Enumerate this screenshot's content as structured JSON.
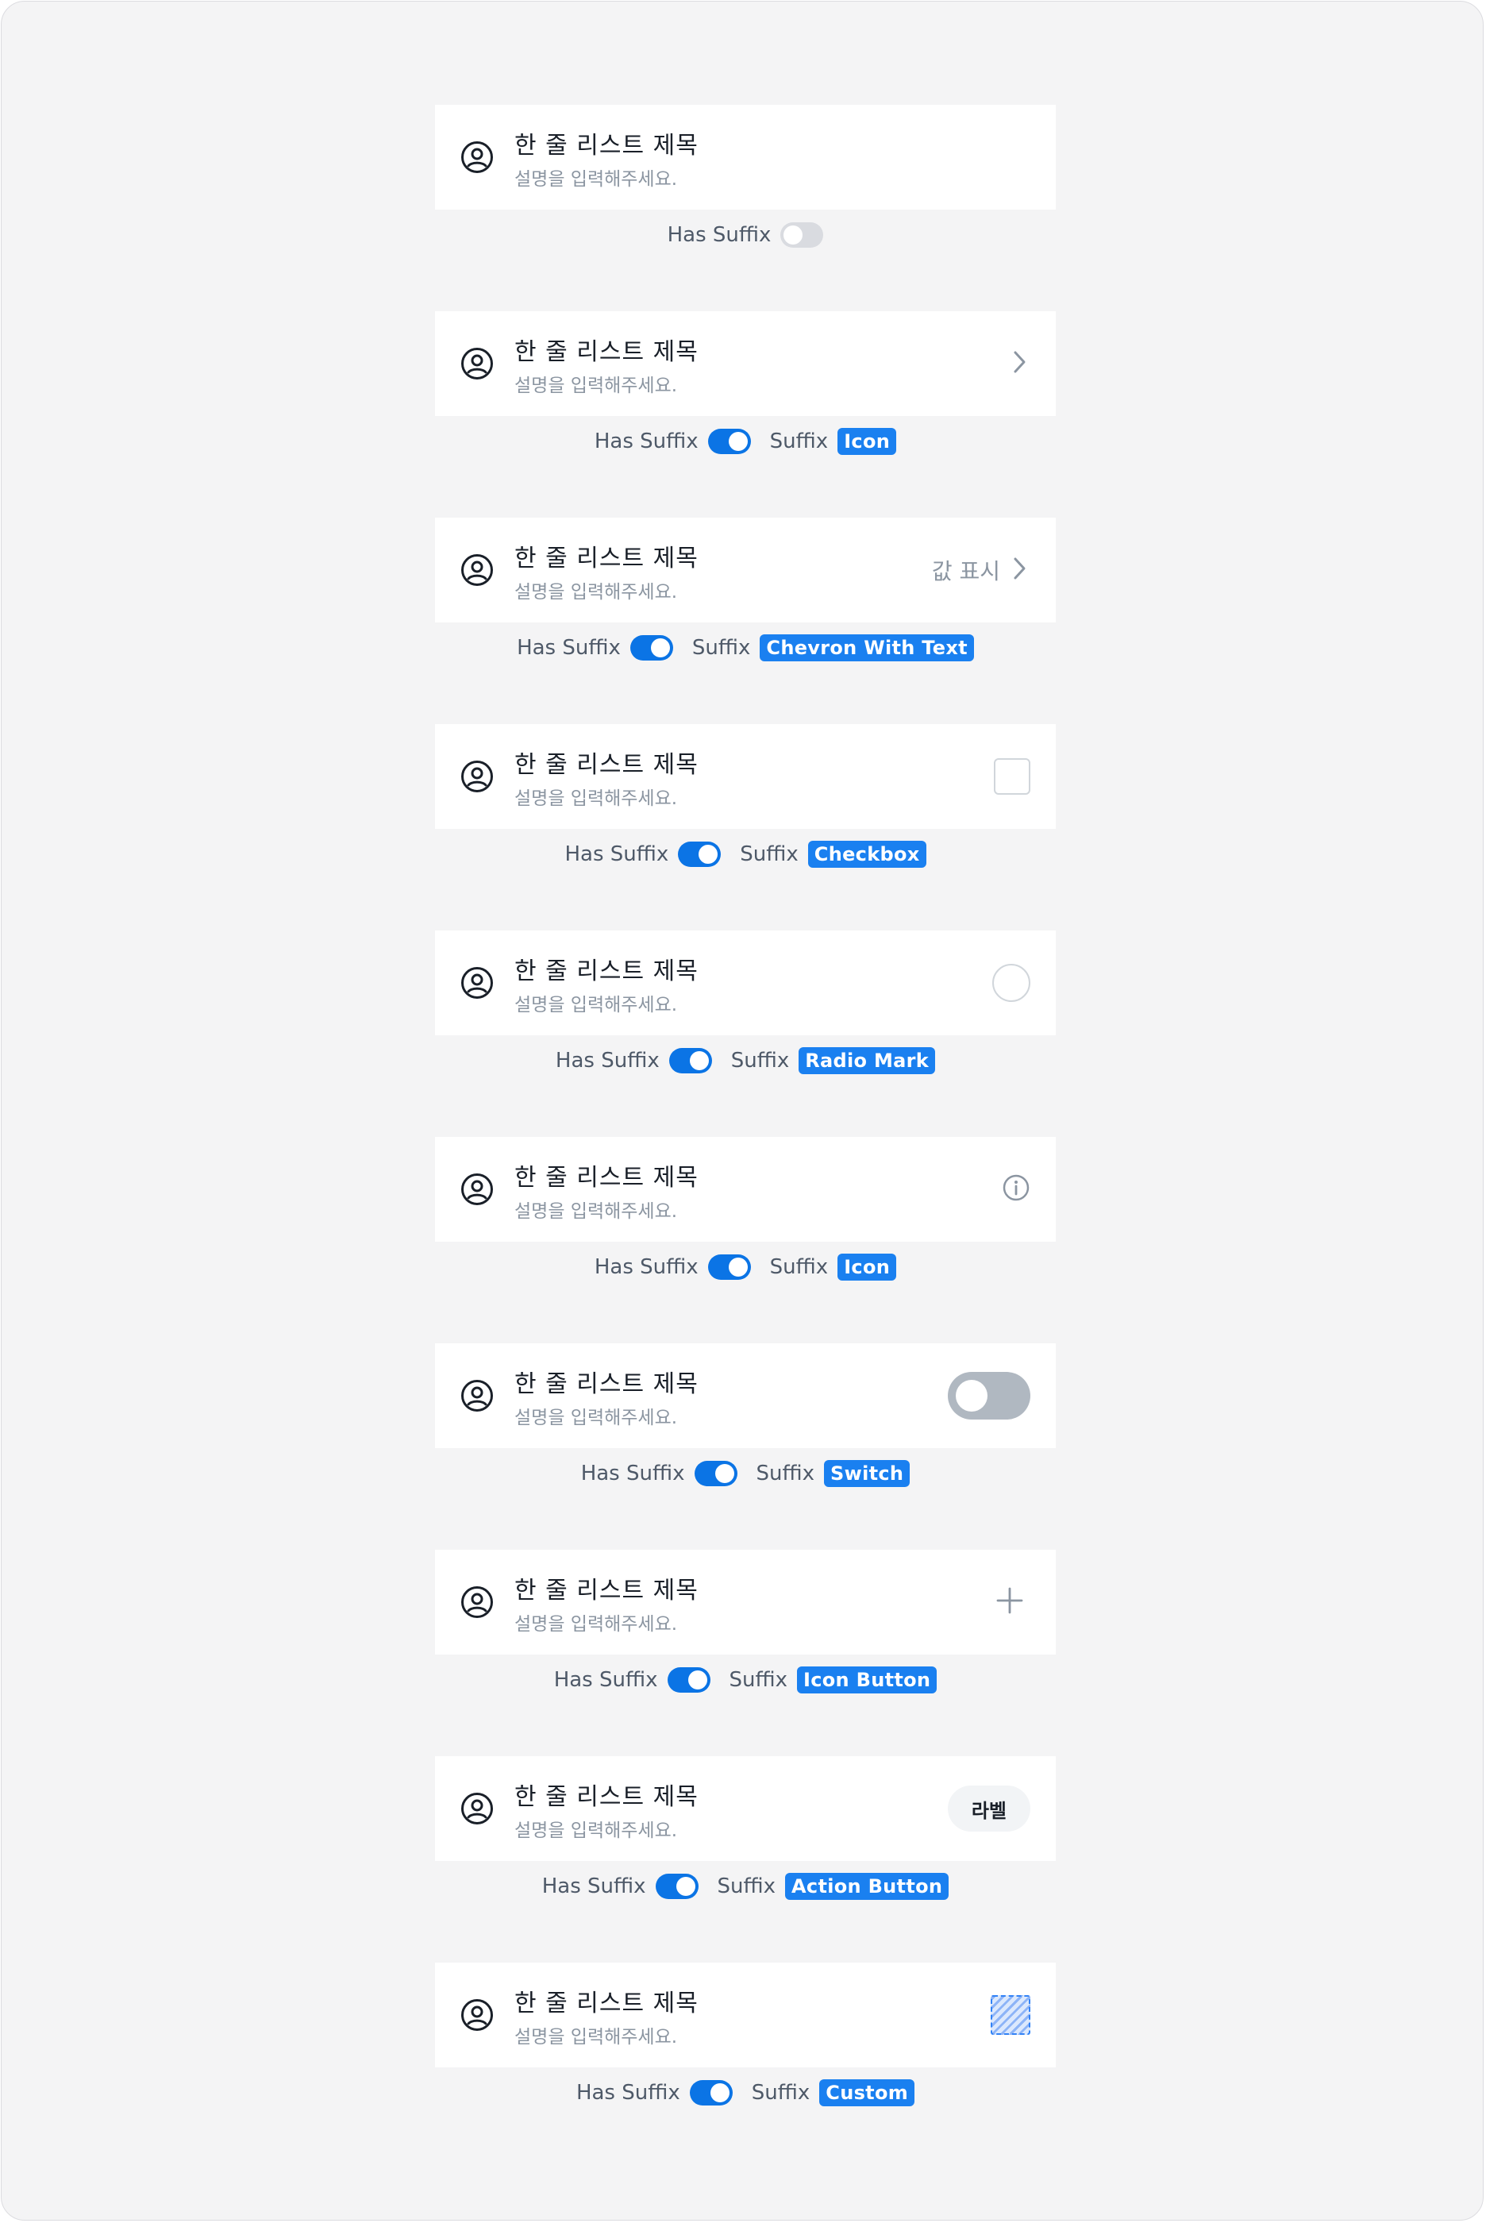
{
  "labels": {
    "has_suffix": "Has Suffix",
    "suffix": "Suffix"
  },
  "colors": {
    "primary": "#1a80f0",
    "background": "#f4f4f5",
    "card": "#ffffff"
  },
  "items": [
    {
      "title": "한 줄 리스트 제목",
      "description": "설명을 입력해주세요.",
      "has_suffix": false,
      "suffix_kind": null,
      "suffix_label": ""
    },
    {
      "title": "한 줄 리스트 제목",
      "description": "설명을 입력해주세요.",
      "has_suffix": true,
      "suffix_kind": "chevron-icon",
      "suffix_label": "Icon"
    },
    {
      "title": "한 줄 리스트 제목",
      "description": "설명을 입력해주세요.",
      "has_suffix": true,
      "suffix_kind": "chevron-with-text",
      "suffix_label": "Chevron With Text",
      "suffix_text": "값 표시"
    },
    {
      "title": "한 줄 리스트 제목",
      "description": "설명을 입력해주세요.",
      "has_suffix": true,
      "suffix_kind": "checkbox",
      "suffix_label": "Checkbox"
    },
    {
      "title": "한 줄 리스트 제목",
      "description": "설명을 입력해주세요.",
      "has_suffix": true,
      "suffix_kind": "radio",
      "suffix_label": "Radio Mark"
    },
    {
      "title": "한 줄 리스트 제목",
      "description": "설명을 입력해주세요.",
      "has_suffix": true,
      "suffix_kind": "info-icon",
      "suffix_label": "Icon"
    },
    {
      "title": "한 줄 리스트 제목",
      "description": "설명을 입력해주세요.",
      "has_suffix": true,
      "suffix_kind": "switch",
      "suffix_label": "Switch",
      "switch_on": false
    },
    {
      "title": "한 줄 리스트 제목",
      "description": "설명을 입력해주세요.",
      "has_suffix": true,
      "suffix_kind": "plus-icon-button",
      "suffix_label": "Icon Button"
    },
    {
      "title": "한 줄 리스트 제목",
      "description": "설명을 입력해주세요.",
      "has_suffix": true,
      "suffix_kind": "action-button",
      "suffix_label": "Action Button",
      "suffix_text": "라벨"
    },
    {
      "title": "한 줄 리스트 제목",
      "description": "설명을 입력해주세요.",
      "has_suffix": true,
      "suffix_kind": "custom",
      "suffix_label": "Custom"
    }
  ]
}
